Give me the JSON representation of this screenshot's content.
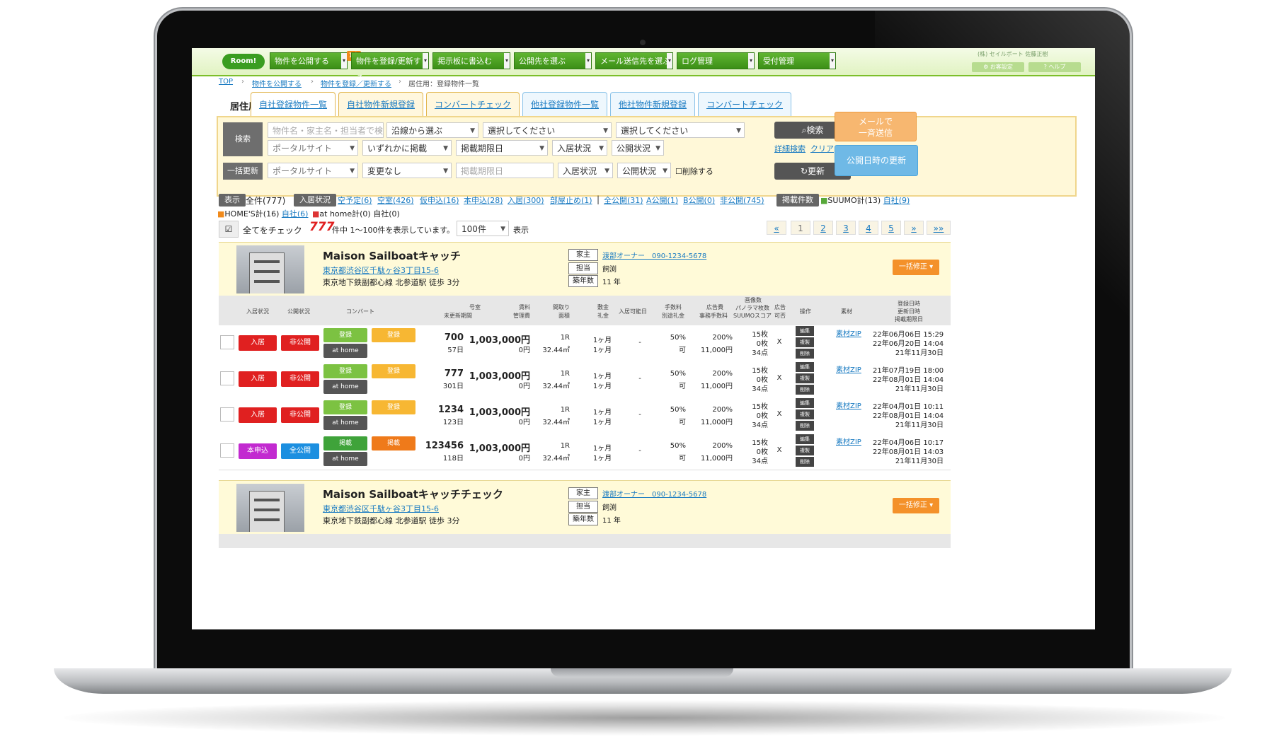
{
  "colors": {
    "nav_green": "#4aa223",
    "accent_orange": "#f4912a",
    "danger_red": "#e02020",
    "public_blue": "#1c8fe0",
    "magenta": "#c22ad0",
    "link_blue": "#1a7bc2"
  },
  "nav": {
    "logo": "Room!",
    "items": [
      {
        "label": "物件を公開する",
        "badge": "1人"
      },
      {
        "label": "物件を登録/更新する"
      },
      {
        "label": "掲示板に書込む"
      },
      {
        "label": "公開先を選ぶ"
      },
      {
        "label": "メール送信先を選ぶ"
      },
      {
        "label": "ログ管理"
      },
      {
        "label": "受付管理"
      }
    ],
    "company": "(株) セイルボート 佐藤正樹",
    "settings": "お客設定",
    "help": "ヘルプ"
  },
  "breadcrumb": [
    "TOP",
    "物件を公開する",
    "物件を登録／更新する",
    "居住用：登録物件一覧"
  ],
  "section_label": "居住用",
  "tabs": [
    "自社登録物件一覧",
    "自社物件新規登録",
    "コンバートチェック",
    "他社登録物件一覧",
    "他社物件新規登録",
    "コンバートチェック"
  ],
  "search": {
    "label": "検索",
    "keyword_placeholder": "物件名・家主名・担当者で検索",
    "line": "沿線から選ぶ",
    "select1": "選択してください",
    "select2": "選択してください",
    "portal": "ポータルサイト",
    "either": "いずれかに掲載",
    "expiry": "掲載期限日",
    "occupancy": "入居状況",
    "publish": "公開状況",
    "search_button": "検索",
    "detail": "詳細検索",
    "clear": "クリア",
    "bulk_label": "一括更新",
    "bulk_portal": "ポータルサイト",
    "no_change": "変更なし",
    "bulk_expiry_placeholder": "掲載期限日",
    "bulk_occupancy": "入居状況",
    "bulk_publish": "公開状況",
    "delete_label": "削除する",
    "update_button": "更新",
    "mail_button": [
      "メールで",
      "一斉送信"
    ],
    "publish_update_button": "公開日時の更新"
  },
  "filters": {
    "display_tag": "表示",
    "all": "全件(777)",
    "occupancy_tag": "入居状況",
    "occupancy_links": [
      "空予定(6)",
      "空室(426)",
      "仮申込(16)",
      "本申込(28)",
      "入居(300)",
      "部屋止め(1)"
    ],
    "publish_links": [
      "全公開(31)",
      "A公開(1)",
      "B公開(0)",
      "非公開(745)"
    ],
    "listing_tag": "掲載件数",
    "suumo": "SUUMO計(13)",
    "suumo_own": "自社(9)",
    "homes": "HOME'S計(16)",
    "homes_own": "自社(6)",
    "athome": "at home計(0) 自社(0)"
  },
  "listbar": {
    "check_all": "全てをチェック",
    "count": "777",
    "count_text": "件中 1～100件を表示しています。",
    "per_page": "100件",
    "show": "表示",
    "pages": [
      "«",
      "1",
      "2",
      "3",
      "4",
      "5",
      "»",
      "»»"
    ]
  },
  "properties": [
    {
      "name": "Maison Sailboatキャッチ",
      "address": "東京都渋谷区千駄ヶ谷3丁目15-6",
      "station": "東京地下鉄副都心線 北参道駅 徒歩 3分",
      "owner_label": "家主",
      "owner": "渡部オーナー　090-1234-5678",
      "staff_label": "担当",
      "staff": "飼渕",
      "age_label": "築年数",
      "age": "11 年",
      "bulk_edit": "一括修正"
    },
    {
      "name": "Maison Sailboatキャッチチェック",
      "address": "東京都渋谷区千駄ヶ谷3丁目15-6",
      "station": "東京地下鉄副都心線 北参道駅 徒歩 3分",
      "owner_label": "家主",
      "owner": "渡部オーナー　090-1234-5678",
      "staff_label": "担当",
      "staff": "飼渕",
      "age_label": "築年数",
      "age": "11 年",
      "bulk_edit": "一括修正"
    }
  ],
  "table_headers": {
    "occupancy": "入居状況",
    "publish": "公開状況",
    "convert": "コンバート",
    "room": "号室",
    "unupdated": "未更新期間",
    "rent": "賃料",
    "mgmt": "管理費",
    "layout": "間取り",
    "area": "面積",
    "deposit": "敷金",
    "key_money": "礼金",
    "move_in": "入居可能日",
    "fee": "手数料",
    "sep_key": "別途礼金",
    "ad_fee": "広告費",
    "office_fee": "事務手数料",
    "images": "画像数",
    "panorama": "パノラマ枚数",
    "suumo_score": "SUUMOスコア",
    "ad": "広告",
    "ad_ok": "可否",
    "ops": "操作",
    "material": "素材",
    "reg_date": "登録日時",
    "upd_date": "更新日時",
    "exp_date": "掲載期限日"
  },
  "rows": [
    {
      "occ": "入居",
      "occ_color": "#e02020",
      "pub": "非公開",
      "pub_color": "#e02020",
      "c1": "登録",
      "c2": "登録",
      "c1c": "#7cc242",
      "c2c": "#f7b733",
      "athome": "at home",
      "room": "700",
      "days": "57日",
      "rent": "1,003,000円",
      "mgmt": "0円",
      "layout": "1R",
      "area": "32.44㎡",
      "deposit": "1ヶ月",
      "key": "1ヶ月",
      "move": "-",
      "fee": "50%",
      "sep": "可",
      "ad": "200%",
      "office": "11,000円",
      "img": "15枚",
      "pano": "0枚",
      "score": "34点",
      "adok": "X",
      "ops": [
        "編集",
        "複製",
        "削除"
      ],
      "mat": "素材ZIP",
      "d1": "22年06月06日 15:29",
      "d2": "22年06月20日 14:04",
      "d3": "21年11月30日"
    },
    {
      "occ": "入居",
      "occ_color": "#e02020",
      "pub": "非公開",
      "pub_color": "#e02020",
      "c1": "登録",
      "c2": "登録",
      "c1c": "#7cc242",
      "c2c": "#f7b733",
      "athome": "at home",
      "room": "777",
      "days": "301日",
      "rent": "1,003,000円",
      "mgmt": "0円",
      "layout": "1R",
      "area": "32.44㎡",
      "deposit": "1ヶ月",
      "key": "1ヶ月",
      "move": "-",
      "fee": "50%",
      "sep": "可",
      "ad": "200%",
      "office": "11,000円",
      "img": "15枚",
      "pano": "0枚",
      "score": "34点",
      "adok": "X",
      "ops": [
        "編集",
        "複製",
        "削除"
      ],
      "mat": "素材ZIP",
      "d1": "21年07月19日 18:00",
      "d2": "22年08月01日 14:04",
      "d3": "21年11月30日"
    },
    {
      "occ": "入居",
      "occ_color": "#e02020",
      "pub": "非公開",
      "pub_color": "#e02020",
      "c1": "登録",
      "c2": "登録",
      "c1c": "#7cc242",
      "c2c": "#f7b733",
      "athome": "at home",
      "room": "1234",
      "days": "123日",
      "rent": "1,003,000円",
      "mgmt": "0円",
      "layout": "1R",
      "area": "32.44㎡",
      "deposit": "1ヶ月",
      "key": "1ヶ月",
      "move": "-",
      "fee": "50%",
      "sep": "可",
      "ad": "200%",
      "office": "11,000円",
      "img": "15枚",
      "pano": "0枚",
      "score": "34点",
      "adok": "X",
      "ops": [
        "編集",
        "複製",
        "削除"
      ],
      "mat": "素材ZIP",
      "d1": "22年04月01日 10:11",
      "d2": "22年08月01日 14:04",
      "d3": "21年11月30日"
    },
    {
      "occ": "本申込",
      "occ_color": "#c22ad0",
      "pub": "全公開",
      "pub_color": "#1c8fe0",
      "c1": "掲載",
      "c2": "掲載",
      "c1c": "#3fa33a",
      "c2c": "#ef7a1a",
      "athome": "at home",
      "room": "123456",
      "days": "118日",
      "rent": "1,003,000円",
      "mgmt": "0円",
      "layout": "1R",
      "area": "32.44㎡",
      "deposit": "1ヶ月",
      "key": "1ヶ月",
      "move": "-",
      "fee": "50%",
      "sep": "可",
      "ad": "200%",
      "office": "11,000円",
      "img": "15枚",
      "pano": "0枚",
      "score": "34点",
      "adok": "X",
      "ops": [
        "編集",
        "複製",
        "削除"
      ],
      "mat": "素材ZIP",
      "d1": "22年04月06日 10:17",
      "d2": "22年08月01日 14:03",
      "d3": "21年11月30日"
    }
  ]
}
